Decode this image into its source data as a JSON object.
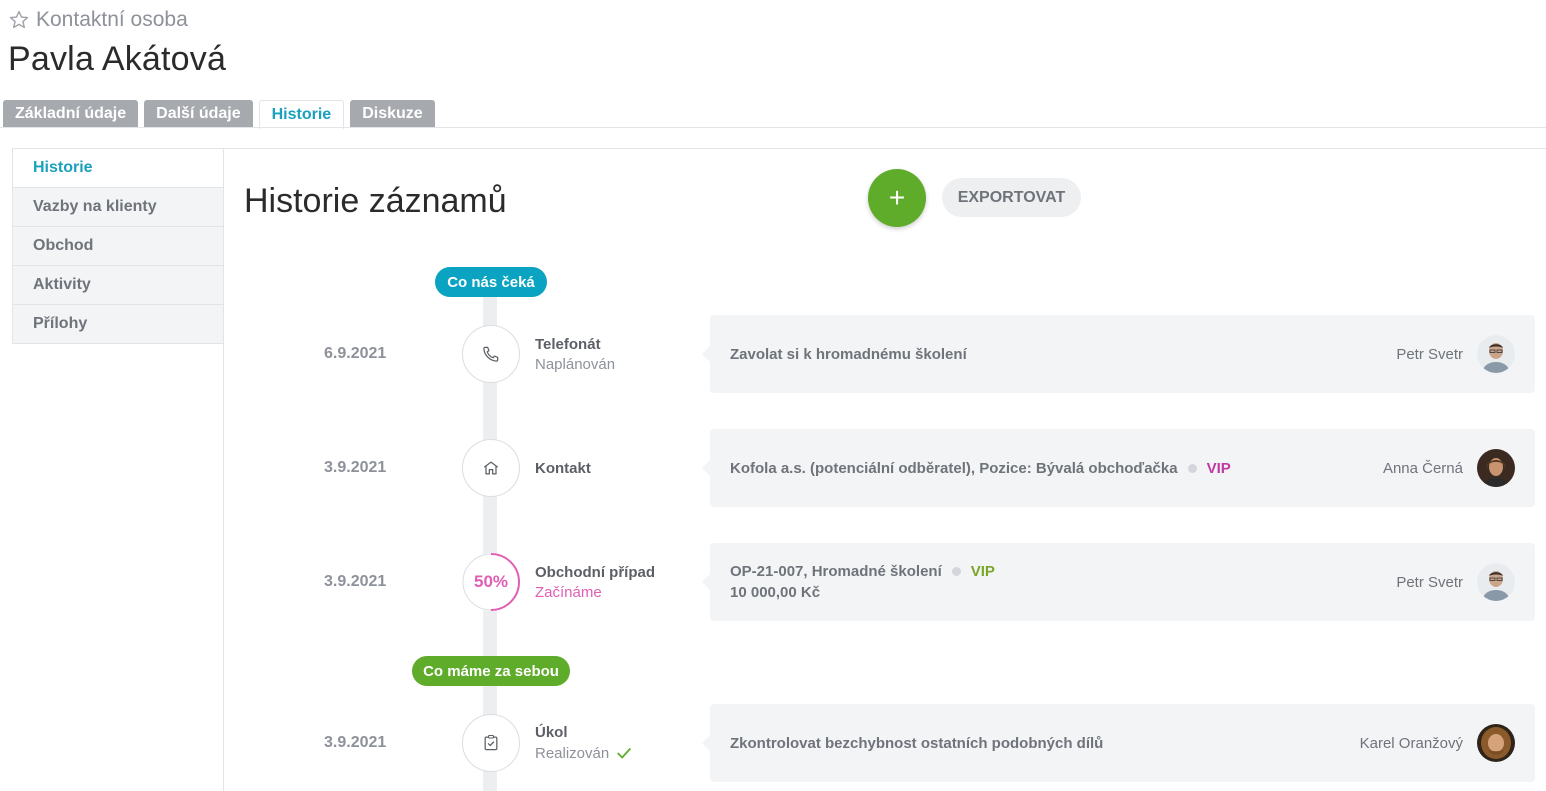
{
  "header": {
    "type_label": "Kontaktní osoba",
    "title": "Pavla Akátová"
  },
  "tabs": [
    {
      "label": "Základní údaje"
    },
    {
      "label": "Další údaje"
    },
    {
      "label": "Historie"
    },
    {
      "label": "Diskuze"
    }
  ],
  "sidebar": {
    "items": [
      {
        "label": "Historie"
      },
      {
        "label": "Vazby na klienty"
      },
      {
        "label": "Obchod"
      },
      {
        "label": "Aktivity"
      },
      {
        "label": "Přílohy"
      }
    ]
  },
  "main": {
    "title": "Historie záznamů",
    "add_label": "+",
    "export_label": "EXPORTOVAT",
    "badge_upcoming": "Co nás čeká",
    "badge_past": "Co máme za sebou"
  },
  "rows": [
    {
      "date": "6.9.2021",
      "icon": "phone-icon",
      "type": "Telefonát",
      "status": "Naplánován",
      "desc": "Zavolat si k hromadnému školení",
      "person": "Petr Svetr"
    },
    {
      "date": "3.9.2021",
      "icon": "home-icon",
      "type": "Kontakt",
      "desc": "Kofola a.s. (potenciální odběratel), Pozice: Bývalá obchoďačka",
      "tag": "VIP",
      "person": "Anna Černá"
    },
    {
      "date": "3.9.2021",
      "icon": "progress-ring",
      "progress_label": "50%",
      "progress": 0.5,
      "type": "Obchodní případ",
      "status": "Začínáme",
      "desc": "OP-21-007, Hromadné školení",
      "tag": "VIP",
      "amount": "10 000,00 Kč",
      "person": "Petr Svetr"
    },
    {
      "date": "3.9.2021",
      "icon": "task-icon",
      "type": "Úkol",
      "status": "Realizován",
      "desc": "Zkontrolovat bezchybnost ostatních podobných dílů",
      "person": "Karel Oranžový"
    }
  ],
  "colors": {
    "accent": "#1ba0bd",
    "green": "#5fab2a",
    "pink": "#e05fb4",
    "vip_pink": "#c039a3",
    "vip_green": "#7aa526"
  }
}
